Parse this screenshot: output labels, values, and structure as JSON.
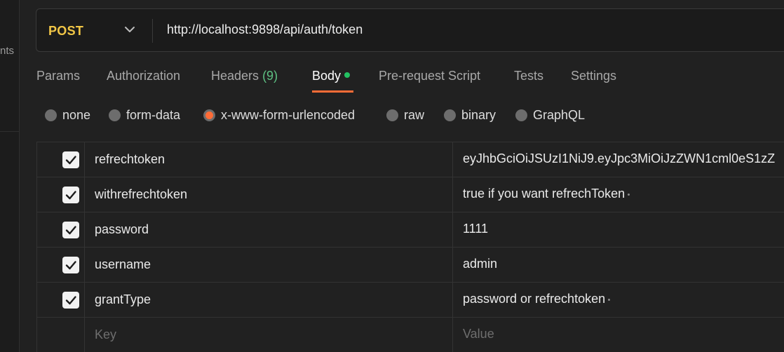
{
  "sidebar": {
    "fragment": "nts"
  },
  "request": {
    "method": "POST",
    "url": "http://localhost:9898/api/auth/token"
  },
  "tabs": [
    {
      "label": "Params"
    },
    {
      "label": "Authorization"
    },
    {
      "label": "Headers",
      "count": "(9)"
    },
    {
      "label": "Body",
      "active": true
    },
    {
      "label": "Pre-request Script"
    },
    {
      "label": "Tests"
    },
    {
      "label": "Settings"
    }
  ],
  "body_types": [
    {
      "label": "none"
    },
    {
      "label": "form-data"
    },
    {
      "label": "x-www-form-urlencoded",
      "selected": true
    },
    {
      "label": "raw"
    },
    {
      "label": "binary"
    },
    {
      "label": "GraphQL"
    }
  ],
  "params": [
    {
      "checked": true,
      "key": "refrechtoken",
      "value": "eyJhbGciOiJSUzI1NiJ9.eyJpc3MiOiJzZWN1cml0eS1zZ"
    },
    {
      "checked": true,
      "key": "withrefrechtoken",
      "value": "true if you want refrechToken",
      "has_description": true
    },
    {
      "checked": true,
      "key": "password",
      "value": "1111"
    },
    {
      "checked": true,
      "key": "username",
      "value": "admin"
    },
    {
      "checked": true,
      "key": "grantType",
      "value": "password or refrechtoken",
      "has_description": true
    }
  ],
  "new_row": {
    "key_placeholder": "Key",
    "value_placeholder": "Value"
  },
  "colors": {
    "method": "#f1c646",
    "accent": "#ff6c37",
    "status_dot": "#23c162",
    "count": "#5ec183"
  }
}
